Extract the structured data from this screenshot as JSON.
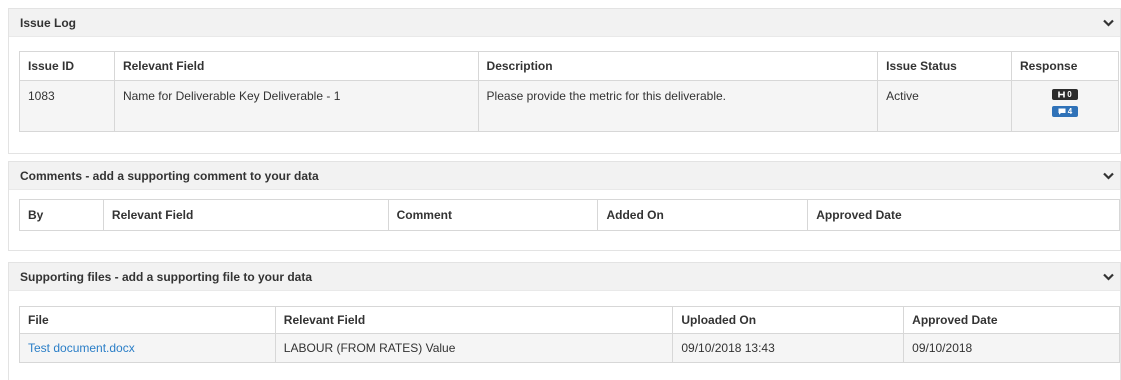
{
  "colors": {
    "link": "#2a7ec7",
    "badge_dark": "#2c2c2c",
    "badge_blue": "#2f72b8"
  },
  "issue_log": {
    "title": "Issue Log",
    "headers": [
      "Issue ID",
      "Relevant Field",
      "Description",
      "Issue Status",
      "Response"
    ],
    "rows": [
      {
        "issue_id": "1083",
        "relevant_field": "Name for Deliverable Key Deliverable - 1",
        "description": "Please provide the metric for this deliverable.",
        "status": "Active",
        "response_badges": [
          {
            "icon": "h-icon",
            "count": "0"
          },
          {
            "icon": "comment-icon",
            "count": "4"
          }
        ]
      }
    ]
  },
  "comments": {
    "title": "Comments - add a supporting comment to your data",
    "headers": [
      "By",
      "Relevant Field",
      "Comment",
      "Added On",
      "Approved Date"
    ]
  },
  "supporting_files": {
    "title": "Supporting files - add a supporting file to your data",
    "headers": [
      "File",
      "Relevant Field",
      "Uploaded On",
      "Approved Date"
    ],
    "rows": [
      {
        "file": "Test document.docx",
        "relevant_field": "LABOUR (FROM RATES) Value",
        "uploaded_on": "09/10/2018 13:43",
        "approved_date": "09/10/2018"
      }
    ]
  }
}
